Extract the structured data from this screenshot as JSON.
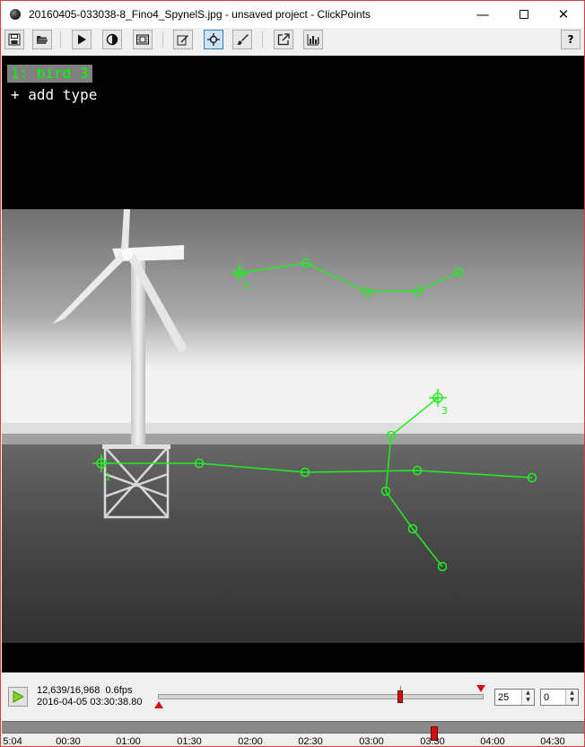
{
  "window": {
    "title": "20160405-033038-8_Fino4_SpynelS.jpg - unsaved project - ClickPoints",
    "controls": {
      "minimize": "—",
      "close": "✕"
    }
  },
  "toolbar": {
    "buttons": [
      {
        "icon": "save-icon",
        "active": false
      },
      {
        "icon": "folder-open-icon",
        "active": false
      },
      {
        "icon": "play-icon",
        "active": false
      },
      {
        "icon": "contrast-icon",
        "active": false
      },
      {
        "icon": "film-icon",
        "active": false
      },
      {
        "icon": "edit-icon",
        "active": false
      },
      {
        "icon": "marker-crosshair-icon",
        "active": true
      },
      {
        "icon": "brush-icon",
        "active": false
      },
      {
        "icon": "export-icon",
        "active": false
      },
      {
        "icon": "chart-icon",
        "active": false
      },
      {
        "icon": "help-icon",
        "active": false
      }
    ],
    "help_label": "?"
  },
  "marker_menu": {
    "types": [
      {
        "label": "1: bird 3",
        "color": "#00ff00"
      }
    ],
    "add_label": "+ add type"
  },
  "tracks": {
    "color": "#22ee22",
    "labels": [
      "1",
      "2",
      "3"
    ]
  },
  "player": {
    "frame_counter": "12,639/16,968",
    "fps": "0.6fps",
    "timestamp": "2016-04-05 03:30:38.80",
    "fps_value": "25",
    "skip_value": "0",
    "position_fraction": 0.745
  },
  "timeline": {
    "labels": [
      "5:04",
      "00:30",
      "01:00",
      "01:30",
      "02:00",
      "02:30",
      "03:00",
      "03:30",
      "04:00",
      "04:30"
    ],
    "marker_label": "03:30"
  }
}
